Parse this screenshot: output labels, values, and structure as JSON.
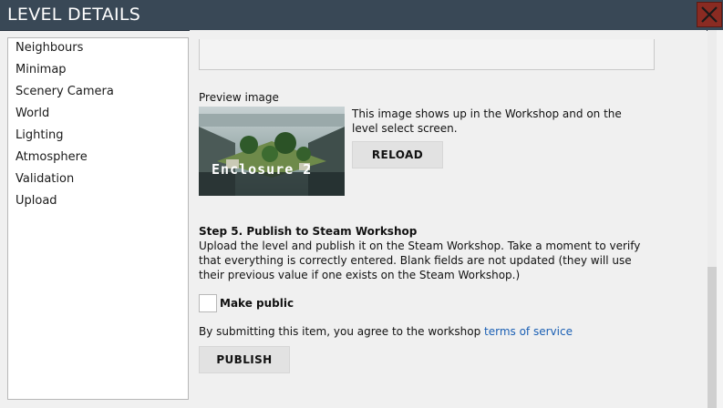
{
  "window": {
    "title": "LEVEL DETAILS"
  },
  "sidebar": {
    "items": [
      {
        "label": "Neighbours"
      },
      {
        "label": "Minimap"
      },
      {
        "label": "Scenery Camera"
      },
      {
        "label": "World"
      },
      {
        "label": "Lighting"
      },
      {
        "label": "Atmosphere"
      },
      {
        "label": "Validation"
      },
      {
        "label": "Upload"
      }
    ]
  },
  "preview": {
    "label": "Preview image",
    "image_caption": "Enclosure 2",
    "description_line1": "This image shows up in the Workshop and on the",
    "description_line2": "level select screen.",
    "reload_label": "RELOAD"
  },
  "publish": {
    "heading": "Step 5. Publish to Steam Workshop",
    "desc_line1": "Upload the level and publish it on the Steam Workshop. Take a moment to verify",
    "desc_line2": "that everything is correctly entered. Blank fields are not updated (they will use",
    "desc_line3": "their previous value if one exists on the Steam Workshop.)",
    "make_public_label": "Make public",
    "agree_text": "By submitting this item, you agree to the workshop ",
    "tos_link": "terms of service",
    "publish_label": "PUBLISH"
  },
  "colors": {
    "titlebar": "#394856",
    "close": "#8a2b22",
    "link": "#1a5fb4",
    "button": "#e2e2e2"
  }
}
